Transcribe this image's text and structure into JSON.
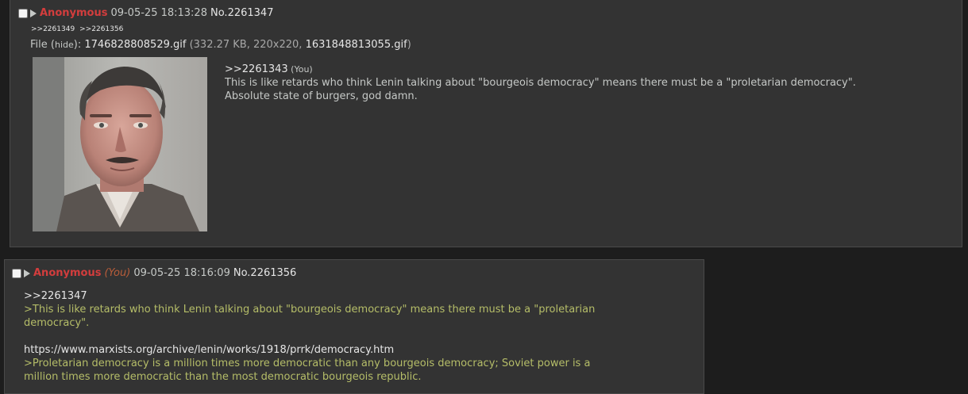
{
  "post1": {
    "name": "Anonymous",
    "datetime": "09-05-25 18:13:28",
    "post_number": "No.2261347",
    "backlinks": [
      ">>2261349",
      ">>2261356"
    ],
    "file_label": "File (",
    "hide_label": "hide",
    "file_label_end": "): ",
    "filename": "1746828808529.gif",
    "file_meta_open": " (332.27 KB, 220x220, ",
    "original_filename": "1631848813055.gif",
    "file_meta_close": ")",
    "quote_link": ">>2261343",
    "quote_you": " (You)",
    "body_lines": [
      "This is like retards who think Lenin talking about \"bourgeois democracy\" means there must be a \"proletarian democracy\".",
      "Absolute state of burgers, god damn."
    ]
  },
  "post2": {
    "name": "Anonymous",
    "you_tag": "(You)",
    "datetime": "09-05-25 18:16:09",
    "post_number": "No.2261356",
    "quote_link": ">>2261347",
    "greentext1": [
      ">This is like retards who think Lenin talking about \"bourgeois democracy\" means there must be a \"proletarian",
      "democracy\"."
    ],
    "link": "https://www.marxists.org/archive/lenin/works/1918/prrk/democracy.htm",
    "greentext2": [
      ">Proletarian democracy is a million times more democratic than any bourgeois democracy; Soviet power is a",
      "million times more democratic than the most democratic bourgeois republic."
    ]
  },
  "colors": {
    "background": "#1d1d1d",
    "post_background": "#333333",
    "name": "#d33d3d",
    "greentext": "#b5bd68",
    "text": "#c5c8c6"
  },
  "icons": [
    "checkbox-icon",
    "expand-triangle-icon"
  ]
}
